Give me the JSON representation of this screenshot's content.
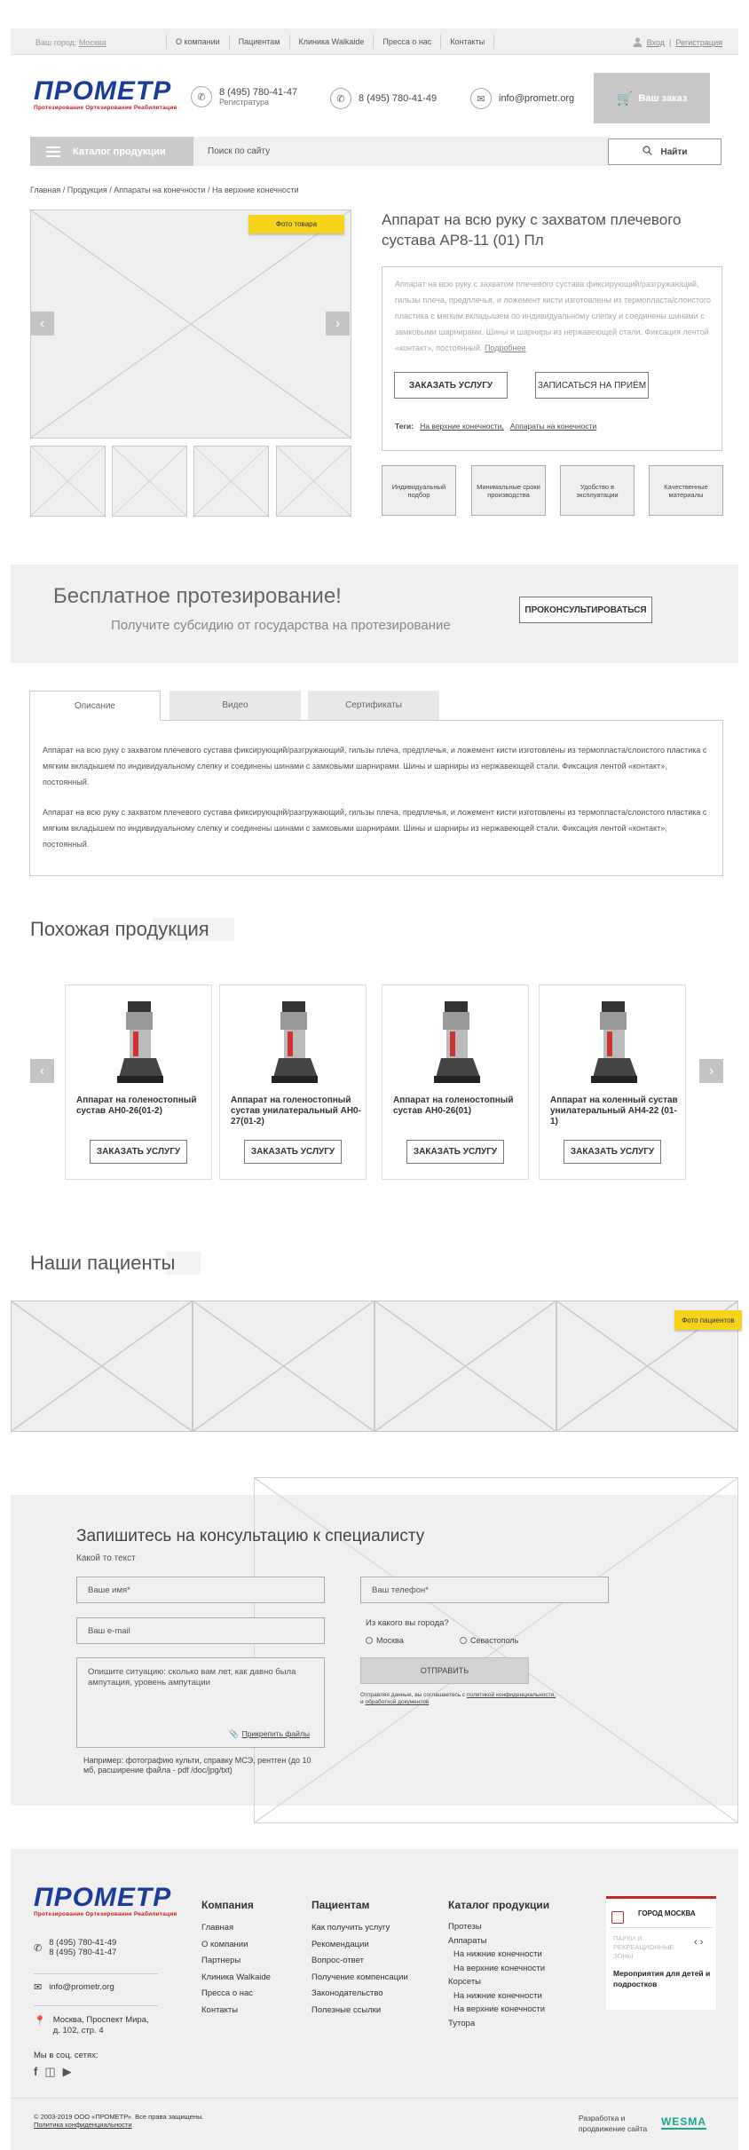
{
  "topbar": {
    "city_label": "Ваш город:",
    "city_value": "Москва",
    "nav": [
      "О компании",
      "Пациентам",
      "Клиника Walkaide",
      "Пресса о нас",
      "Контакты"
    ],
    "login": "Вход",
    "separator": "|",
    "register": "Регистрация"
  },
  "header": {
    "logo_text": "ПРОМЕТР",
    "logo_sub": "Протезирование Ортезирование Реабилитация",
    "phone1": "8 (495) 780-41-47",
    "phone1_caption": "Регистратура",
    "phone2": "8 (495) 780-41-49",
    "email": "info@prometr.org",
    "cart_label": "Ваш заказ"
  },
  "nav": {
    "catalog_label": "Каталог продукции",
    "search_placeholder": "Поиск по сайту",
    "search_button": "Найти"
  },
  "breadcrumb": "Главная / Продукция / Аппараты на конечности / На верхние конечности",
  "product": {
    "photo_badge": "Фото товара",
    "title": "Аппарат на всю руку с захватом плечевого сустава АР8-11 (01) Пл",
    "description": "Аппарат на всю руку с захватом плечевого сустава фиксирующий/разгружающий, гильзы плеча, предплечья, и ложемент кисти изготовлены из термопласта/слоистого пластика с мягким вкладышем по индивидуальному слепку и соединены шинами с замковыми шарнирами. Шины и шарниры из нержавеющей стали. Фиксация лентой «контакт», постоянный.",
    "more_link": "Подробнее",
    "order_button": "ЗАКАЗАТЬ УСЛУГУ",
    "appointment_button": "ЗАПИСАТЬСЯ НА ПРИЁМ",
    "tags_label": "Теги:",
    "tags": [
      "На верхние конечности,",
      "Аппараты на конечности"
    ],
    "features": [
      "Индивидуальный подбор",
      "Минимальные сроки производства",
      "Удобство в эксплуатации",
      "Качественные материалы"
    ]
  },
  "promo": {
    "title": "Бесплатное протезирование!",
    "subtitle": "Получите субсидию от государства на протезирование",
    "button": "ПРОКОНСУЛЬТИРОВАТЬСЯ"
  },
  "tabs": {
    "items": [
      "Описание",
      "Видео",
      "Сертификаты"
    ],
    "active": 0,
    "paragraphs": [
      "Аппарат на всю руку с захватом плечевого сустава фиксирующий/разгружающий, гильзы плеча, предплечья, и ложемент кисти изготовлены из термопласта/слоистого пластика с мягким вкладышем по индивидуальному слепку и соединены шинами с замковыми шарнирами. Шины и шарниры из нержавеющей стали. Фиксация лентой «контакт», постоянный.",
      "Аппарат на всю руку с захватом плечевого сустава фиксирующий/разгружающий, гильзы плеча, предплечья, и ложемент кисти изготовлены из термопласта/слоистого пластика с мягким вкладышем по индивидуальному слепку и соединены шинами с замковыми шарнирами. Шины и шарниры из нержавеющей стали. Фиксация лентой «контакт», постоянный."
    ]
  },
  "similar": {
    "title": "Похожая продукция",
    "items": [
      {
        "name": "Аппарат на голеностопный сустав АН0-26(01-2)",
        "button": "ЗАКАЗАТЬ УСЛУГУ"
      },
      {
        "name": "Аппарат на голеностопный сустав унилатеральный АН0-27(01-2)",
        "button": "ЗАКАЗАТЬ УСЛУГУ"
      },
      {
        "name": "Аппарат на голеностопный сустав АН0-26(01)",
        "button": "ЗАКАЗАТЬ УСЛУГУ"
      },
      {
        "name": "Аппарат на коленный сустав унилатеральный АН4-22 (01-1)",
        "button": "ЗАКАЗАТЬ УСЛУГУ"
      }
    ]
  },
  "patients": {
    "title": "Наши пациенты",
    "badge": "Фото пациентов"
  },
  "form": {
    "title": "Запишитесь на консультацию к специалисту",
    "subtitle": "Какой то текст",
    "name_placeholder": "Ваше имя*",
    "phone_placeholder": "Ваш телефон*",
    "email_placeholder": "Ваш e-mail",
    "city_question": "Из какого вы города?",
    "cities": [
      "Москва",
      "Севастополь"
    ],
    "situation_placeholder": "Опишите ситуацию: сколько вам лет, как давно была ампутация, уровень ампутации",
    "attach_label": "Прикрепить файлы",
    "submit": "ОТПРАВИТЬ",
    "consent_prefix": "Отправляя данные, вы соглашаетесь с",
    "consent_link1": "политикой конфиденциальности,",
    "consent_mid": "и",
    "consent_link2": "обработкой документов",
    "hint": "Например: фотографию культи, справку МСЭ, рентген (до 10 мб, расширение файла - pdf /doc/jpg/txt)"
  },
  "footer": {
    "phones": [
      "8 (495) 780-41-49",
      "8 (495) 780-41-47"
    ],
    "email": "info@prometr.org",
    "address": "Москва, Проспект Мира, д. 102, стр. 4",
    "social_label": "Мы в соц. сетях:",
    "columns": [
      {
        "title": "Компания",
        "items": [
          "Главная",
          "О компании",
          "Партнеры",
          "Клиника Walkaide",
          "Пресса о нас",
          "Контакты"
        ]
      },
      {
        "title": "Пациентам",
        "items": [
          "Как получить услугу",
          "Рекомендации",
          "Вопрос-ответ",
          "Получение компенсации",
          "Законодательство",
          "Полезные ссылки"
        ]
      },
      {
        "title": "Каталог продукции",
        "items": [
          "Протезы",
          "Аппараты",
          "На нижние конечности",
          "На верхние конечности",
          "Корсеты",
          "На нижние конечности",
          "На верхние конечности",
          "Тутора"
        ]
      }
    ],
    "widget": {
      "city": "ГОРОД МОСКВА",
      "faded": "ПАРКИ И РЕКРЕАЦИОННЫЕ ЗОНЫ",
      "event": "Мероприятия для детей и подростков"
    },
    "copyright": "© 2003-2019 ООО «ПРОМЕТР». Все права защищены.",
    "privacy": "Политика конфиденциальности",
    "dev_label": "Разработка и продвижение сайта",
    "dev_logo": "WESMA"
  }
}
